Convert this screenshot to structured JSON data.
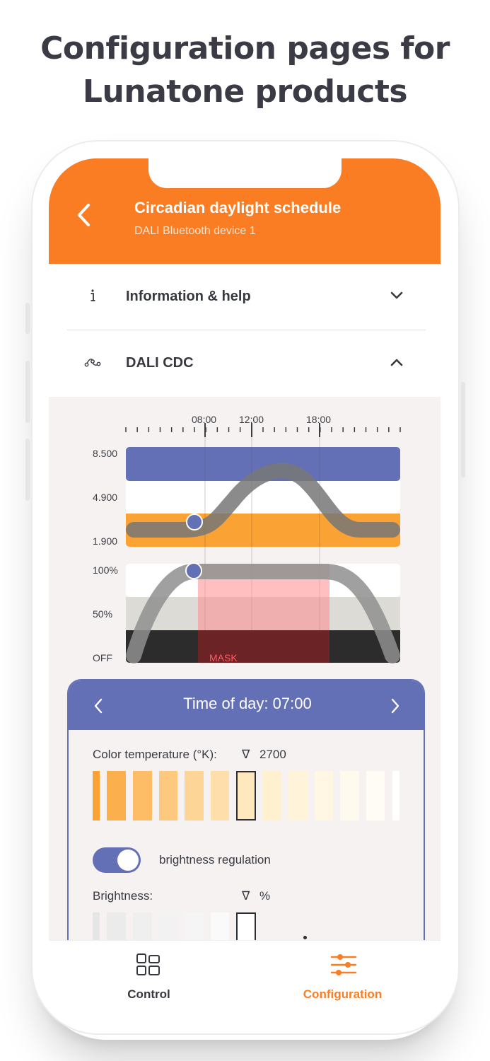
{
  "headline": {
    "line1": "Configuration pages for",
    "line2": "Lunatone products"
  },
  "appbar": {
    "title": "Circadian daylight schedule",
    "subtitle": "DALI Bluetooth device 1",
    "back_icon": "chevron-left-icon",
    "color": "#fa7d23"
  },
  "sections": [
    {
      "label": "Information & help",
      "icon": "info-icon",
      "state": "collapsed"
    },
    {
      "label": "DALI CDC",
      "icon": "curve-nodes-icon",
      "state": "expanded"
    }
  ],
  "schedule": {
    "time_ticks": [
      "08:00",
      "12:00",
      "18:00"
    ],
    "color_axis": [
      "8.500",
      "4.900",
      "1.900"
    ],
    "brightness_axis": [
      "100%",
      "50%",
      "OFF"
    ],
    "mask_label": "MASK",
    "colors": {
      "cool": "#6470b5",
      "warm": "#fba234",
      "mask": "#ff8a8e",
      "curve": "#8c8c8c"
    }
  },
  "time_card": {
    "title": "Time of day: 07:00",
    "color_temperature_label": "Color temperature (°K):",
    "color_temperature_marker": "∇",
    "color_temperature_value": "2700",
    "toggle_label": "brightness regulation",
    "toggle_on": true,
    "brightness_label": "Brightness:",
    "brightness_marker": "∇",
    "brightness_unit": "%"
  },
  "tabbar": {
    "tabs": [
      {
        "label": "Control",
        "icon": "grid-icon",
        "active": false
      },
      {
        "label": "Configuration",
        "icon": "sliders-icon",
        "active": true
      }
    ],
    "active_color": "#fa7d23"
  }
}
